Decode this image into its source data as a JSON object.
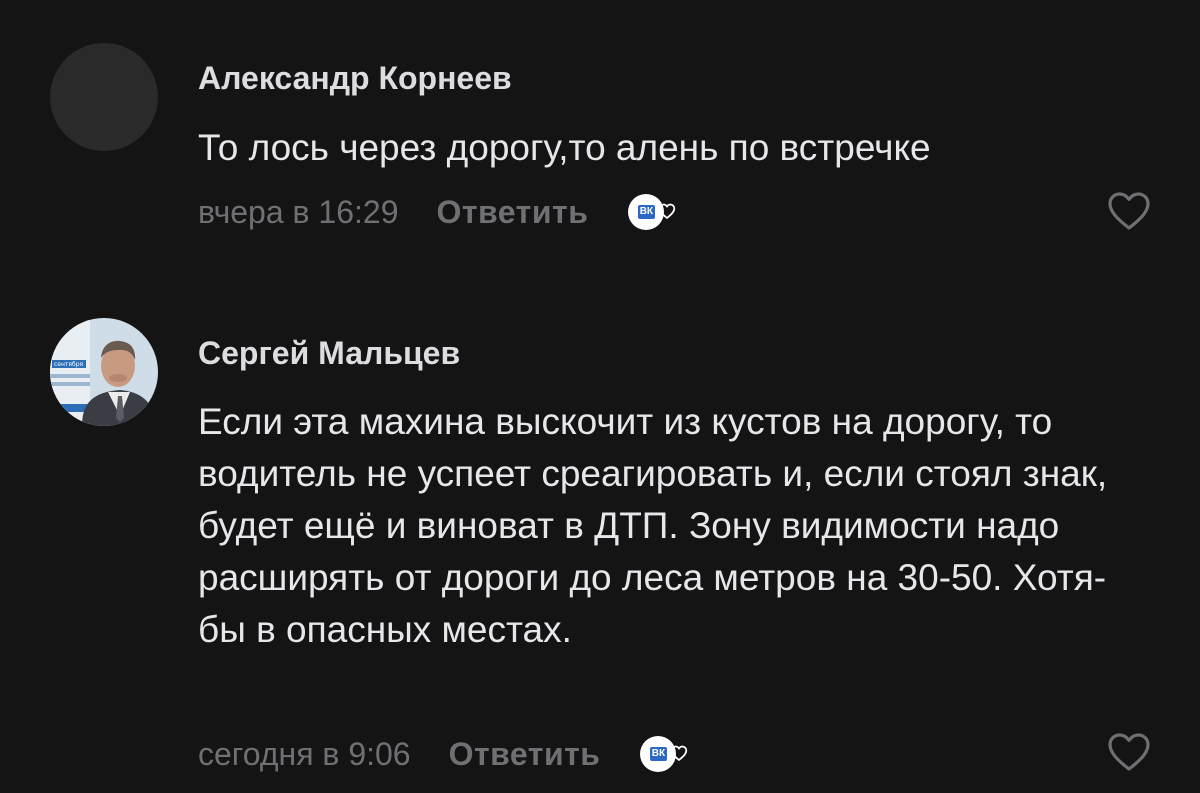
{
  "comments": [
    {
      "author": "Александр Корнеев",
      "text": "То лось через дорогу,то алень по встречке",
      "time": "вчера в 16:29",
      "reply_label": "Ответить",
      "reaction_badge": "ВК",
      "avatar_icon": "avatar-placeholder"
    },
    {
      "author": "Сергей Мальцев",
      "text": "Если эта махина выскочит из кустов на дорогу, то водитель не успеет среагировать и, если стоял знак, будет ещё и виноват в ДТП. Зону видимости надо расширять от дороги до леса метров на 30-50. Хотя-бы в опасных местах.",
      "time": "сегодня в 9:06",
      "reply_label": "Ответить",
      "reaction_badge": "ВК",
      "avatar_icon": "user-photo",
      "avatar_caption": "сентября"
    }
  ],
  "colors": {
    "background": "#141414",
    "meta_text": "#6f7073",
    "body_text": "#e6e7ea",
    "badge_blue": "#2b69c4"
  }
}
